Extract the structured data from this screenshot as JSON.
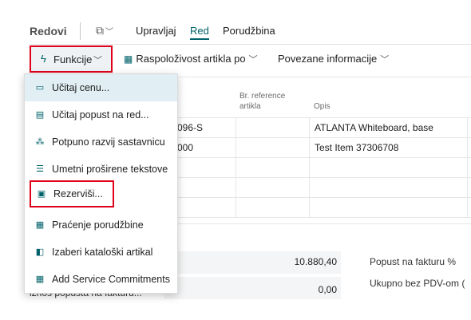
{
  "header": {
    "title": "Redovi",
    "tabs": [
      {
        "label": "Upravljaj"
      },
      {
        "label": "Red"
      },
      {
        "label": "Porudžbina"
      }
    ]
  },
  "actions": {
    "funkcije": "Funkcije",
    "raspolozivost": "Raspoloživost artikla po",
    "povezane": "Povezane informacije"
  },
  "grid": {
    "columns": {
      "ref_line1": "Br. reference",
      "ref_line2": "artikla",
      "opis": "Opis"
    },
    "rows": [
      {
        "no": "096-S",
        "opis": "ATLANTA Whiteboard, base"
      },
      {
        "no": "000",
        "opis": "Test Item 37306708"
      }
    ]
  },
  "totals": {
    "value1": "10.880,40",
    "value2": "0,00",
    "label_left_partial": "iznos popusta na fakturu...",
    "label_right1": "Popust na fakturu %",
    "label_right2": "Ukupno bez PDV-om ("
  },
  "menu": {
    "items": [
      {
        "label": "Učitaj cenu...",
        "icon": "price-tag-icon"
      },
      {
        "label": "Učitaj popust na red...",
        "icon": "discount-icon"
      },
      {
        "label": "Potpuno razvij sastavnicu",
        "icon": "hierarchy-icon"
      },
      {
        "label": "Umetni proširene tekstove",
        "icon": "text-lines-icon"
      },
      {
        "label": "Rezerviši...",
        "icon": "reserve-icon"
      },
      {
        "label": "Praćenje porudžbine",
        "icon": "order-tracking-icon"
      },
      {
        "label": "Izaberi kataloški artikal",
        "icon": "catalog-icon"
      },
      {
        "label": "Add Service Commitments",
        "icon": "service-grid-icon"
      }
    ]
  },
  "colors": {
    "accent": "#00626a",
    "highlight": "#e0001b",
    "hover": "#e1eef4"
  }
}
